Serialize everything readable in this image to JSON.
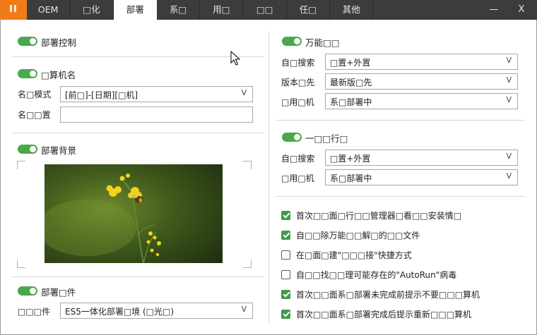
{
  "tabbar": {
    "logo": "II",
    "tabs": [
      {
        "label": "OEM",
        "active": false
      },
      {
        "label": "□化",
        "active": false
      },
      {
        "label": "部署",
        "active": true
      },
      {
        "label": "系□",
        "active": false
      },
      {
        "label": "用□",
        "active": false
      },
      {
        "label": "□□",
        "active": false
      },
      {
        "label": "任□",
        "active": false
      },
      {
        "label": "其他",
        "active": false
      }
    ],
    "minimize": "—",
    "close": "X"
  },
  "left": {
    "deploy_control": {
      "title": "部署控制",
      "enabled": true
    },
    "computer_name": {
      "title": "□算机名",
      "enabled": true,
      "mode_label": "名□模式",
      "mode_value": "[前□]-[日期][□机]",
      "settings_label": "名□□置",
      "settings_value": ""
    },
    "deploy_background": {
      "title": "部署背景",
      "enabled": true
    },
    "deploy_component": {
      "title": "部署□件",
      "enabled": true,
      "field_label": "□□□件",
      "field_value": "ES5一体化部署□境 (□光□)"
    }
  },
  "right": {
    "universal_driver": {
      "title": "万能□□",
      "enabled": true,
      "rows": [
        {
          "label": "自□搜索",
          "value": "□置+外置"
        },
        {
          "label": "版本□先",
          "value": "最新版□先"
        },
        {
          "label": "□用□机",
          "value": "系□部署中"
        }
      ]
    },
    "one_click_run": {
      "title": "一□□行□",
      "enabled": true,
      "rows": [
        {
          "label": "自□搜索",
          "value": "□置+外置"
        },
        {
          "label": "□用□机",
          "value": "系□部署中"
        }
      ]
    },
    "options": [
      {
        "label": "首次□□面□行□□管理器□看□□安装情□",
        "checked": true
      },
      {
        "label": "自□□除万能□□解□的□□文件",
        "checked": true
      },
      {
        "label": "在□面□建\"□□□接\"快捷方式",
        "checked": false
      },
      {
        "label": "自□□找□□理可能存在的\"AutoRun\"病毒",
        "checked": false
      },
      {
        "label": "首次□□面系□部署未完成前提示不要□□□算机",
        "checked": true
      },
      {
        "label": "首次□□面系□部署完成后提示重新□□□算机",
        "checked": true
      }
    ]
  },
  "colors": {
    "accent": "#f07c18",
    "toggle_on": "#4aa84a",
    "check_on": "#3f9b4a",
    "tabbar": "#3c3c3c"
  }
}
